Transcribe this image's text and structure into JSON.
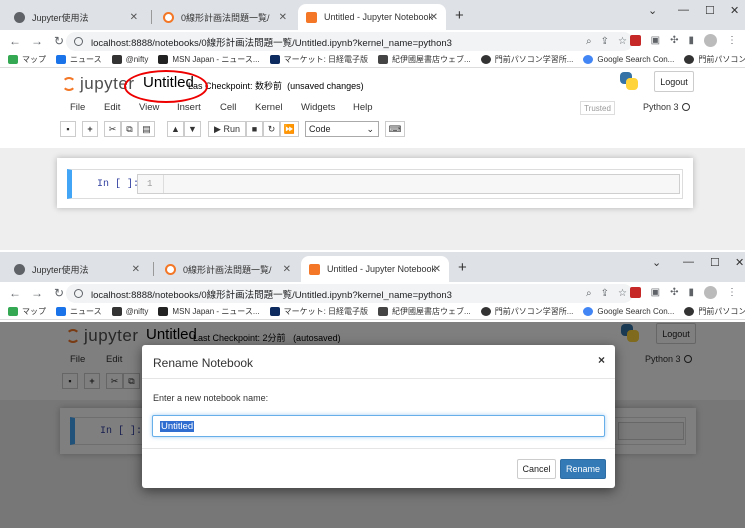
{
  "top": {
    "tabs": [
      {
        "label": "Jupyter使用法"
      },
      {
        "label": "0線形計画法問題一覧/"
      },
      {
        "label": "Untitled - Jupyter Notebook"
      }
    ],
    "url": "localhost:8888/notebooks/0線形計画法問題一覧/Untitled.ipynb?kernel_name=python3",
    "bookmarks": [
      "マップ",
      "ニュース",
      "@nifty",
      "MSN Japan - ニュース...",
      "マーケット: 日経電子版",
      "紀伊國屋書店ウェブ...",
      "門前パソコン学習所...",
      "Google Search Con...",
      "門前パソコン学習所"
    ],
    "notebook_name": "Untitled",
    "checkpoint_prefix": "Las",
    "checkpoint_rest": "Checkpoint: 数秒前",
    "save_status": "(unsaved changes)",
    "logout": "Logout",
    "menus": [
      "File",
      "Edit",
      "View",
      "Insert",
      "Cell",
      "Kernel",
      "Widgets",
      "Help"
    ],
    "trusted": "Trusted",
    "kernel": "Python 3",
    "run": "Run",
    "cell_type": "Code",
    "prompt": "In [ ]:",
    "line_number": "1"
  },
  "bottom": {
    "tabs": [
      {
        "label": "Jupyter使用法"
      },
      {
        "label": "0線形計画法問題一覧/"
      },
      {
        "label": "Untitled - Jupyter Notebook"
      }
    ],
    "url": "localhost:8888/notebooks/0線形計画法問題一覧/Untitled.ipynb?kernel_name=python3",
    "bookmarks": [
      "マップ",
      "ニュース",
      "@nifty",
      "MSN Japan - ニュース...",
      "マーケット: 日経電子版",
      "紀伊國屋書店ウェブ...",
      "門前パソコン学習所...",
      "Google Search Con...",
      "門前パソコン学習所"
    ],
    "notebook_name": "Untitled",
    "checkpoint": "Last Checkpoint: 2分前",
    "save_status": "(autosaved)",
    "logout": "Logout",
    "menus": [
      "File",
      "Edit"
    ],
    "kernel": "Python 3",
    "prompt": "In [ ]:",
    "modal": {
      "title": "Rename Notebook",
      "close": "×",
      "label": "Enter a new notebook name:",
      "value": "Untitled",
      "cancel": "Cancel",
      "rename": "Rename"
    }
  }
}
